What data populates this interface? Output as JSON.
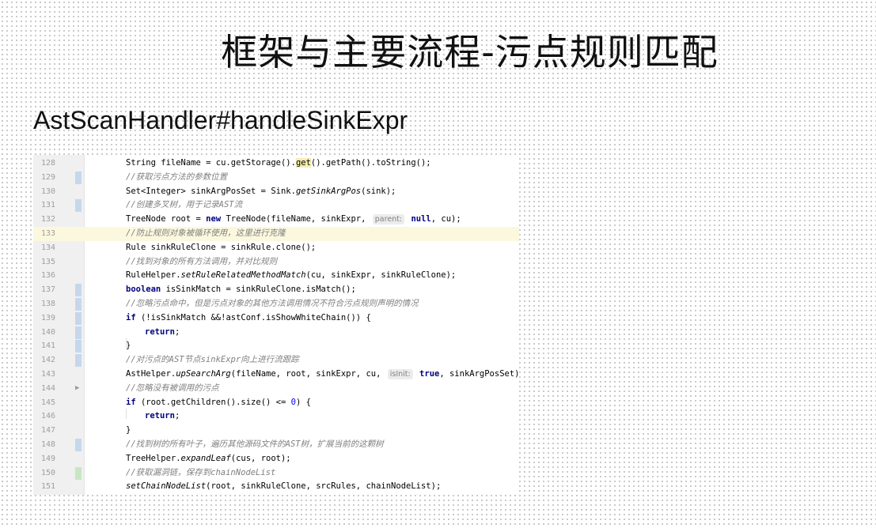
{
  "slide": {
    "title": "框架与主要流程-污点规则匹配",
    "subtitle": "AstScanHandler#handleSinkExpr"
  },
  "editor": {
    "lines": [
      {
        "n": "128",
        "mark": "none",
        "t": [
          [
            "String fileName = cu.getStorage().",
            ""
          ],
          [
            "get",
            "hlw"
          ],
          [
            "().getPath().toString();",
            ""
          ]
        ]
      },
      {
        "n": "129",
        "mark": "blue",
        "t": [
          [
            "//获取污点方法的参数位置",
            "cm"
          ]
        ]
      },
      {
        "n": "130",
        "mark": "none",
        "t": [
          [
            "Set<Integer> sinkArgPosSet = Sink.",
            ""
          ],
          [
            "getSinkArgPos",
            "mi"
          ],
          [
            "(sink);",
            ""
          ]
        ]
      },
      {
        "n": "131",
        "mark": "blue",
        "t": [
          [
            "//创建多叉树，用于记录AST流",
            "cm"
          ]
        ]
      },
      {
        "n": "132",
        "mark": "none",
        "t": [
          [
            "TreeNode root = ",
            ""
          ],
          [
            "new",
            "kw"
          ],
          [
            " TreeNode(fileName, sinkExpr, ",
            ""
          ],
          [
            "parent:",
            "hint"
          ],
          [
            " ",
            ""
          ],
          [
            "null",
            "kw"
          ],
          [
            ", cu);",
            ""
          ]
        ]
      },
      {
        "n": "133",
        "mark": "none",
        "hl": true,
        "t": [
          [
            "//防止规则对象被循环使用，这里进行克隆",
            "cm"
          ]
        ]
      },
      {
        "n": "134",
        "mark": "none",
        "t": [
          [
            "Rule sinkRuleClone = sinkRule.clone();",
            ""
          ]
        ]
      },
      {
        "n": "135",
        "mark": "none",
        "t": [
          [
            "//找到对象的所有方法调用，并对比规则",
            "cm"
          ]
        ]
      },
      {
        "n": "136",
        "mark": "none",
        "t": [
          [
            "RuleHelper.",
            ""
          ],
          [
            "setRuleRelatedMethodMatch",
            "mi"
          ],
          [
            "(cu, sinkExpr, sinkRuleClone);",
            ""
          ]
        ]
      },
      {
        "n": "137",
        "mark": "blue",
        "t": [
          [
            "boolean",
            "kw"
          ],
          [
            " isSinkMatch = sinkRuleClone.isMatch();",
            ""
          ]
        ]
      },
      {
        "n": "138",
        "mark": "blue",
        "t": [
          [
            "//忽略污点命中，但是污点对象的其他方法调用情况不符合污点规则声明的情况",
            "cm"
          ]
        ]
      },
      {
        "n": "139",
        "mark": "blue",
        "t": [
          [
            "if",
            "kw"
          ],
          [
            " (!isSinkMatch &&!astConf.isShowWhiteChain()) {",
            ""
          ]
        ]
      },
      {
        "n": "140",
        "mark": "blue",
        "indent": true,
        "t": [
          [
            "return",
            "kw"
          ],
          [
            ";",
            ""
          ]
        ]
      },
      {
        "n": "141",
        "mark": "blue",
        "t": [
          [
            "}",
            ""
          ]
        ]
      },
      {
        "n": "142",
        "mark": "blue",
        "t": [
          [
            "//对污点的AST节点sinkExpr向上进行流跟踪",
            "cm"
          ]
        ]
      },
      {
        "n": "143",
        "mark": "none",
        "t": [
          [
            "AstHelper.",
            ""
          ],
          [
            "upSearchArg",
            "mi"
          ],
          [
            "(fileName, root, sinkExpr, cu, ",
            ""
          ],
          [
            "isInit:",
            "hint"
          ],
          [
            " ",
            ""
          ],
          [
            "true",
            "kw"
          ],
          [
            ", sinkArgPosSet);",
            ""
          ]
        ]
      },
      {
        "n": "144",
        "mark": "fold",
        "t": [
          [
            "//忽略没有被调用的污点",
            "cm"
          ]
        ]
      },
      {
        "n": "145",
        "mark": "none",
        "t": [
          [
            "if",
            "kw"
          ],
          [
            " (root.getChildren().size() <= ",
            ""
          ],
          [
            "0",
            "num"
          ],
          [
            ") {",
            ""
          ]
        ]
      },
      {
        "n": "146",
        "mark": "none",
        "indent": true,
        "t": [
          [
            "return",
            "kw"
          ],
          [
            ";",
            ""
          ]
        ]
      },
      {
        "n": "147",
        "mark": "none",
        "t": [
          [
            "}",
            ""
          ]
        ]
      },
      {
        "n": "148",
        "mark": "blue",
        "t": [
          [
            "//找到树的所有叶子，遍历其他源码文件的AST树，扩展当前的这颗树",
            "cm"
          ]
        ]
      },
      {
        "n": "149",
        "mark": "none",
        "t": [
          [
            "TreeHelper.",
            ""
          ],
          [
            "expandLeaf",
            "mi"
          ],
          [
            "(cus, root);",
            ""
          ]
        ]
      },
      {
        "n": "150",
        "mark": "green",
        "t": [
          [
            "//获取漏洞链，保存到chainNodeList",
            "cm"
          ]
        ]
      },
      {
        "n": "151",
        "mark": "none",
        "t": [
          [
            "setChainNodeList",
            "mi"
          ],
          [
            "(root, sinkRuleClone, srcRules, chainNodeList);",
            ""
          ]
        ]
      }
    ]
  }
}
